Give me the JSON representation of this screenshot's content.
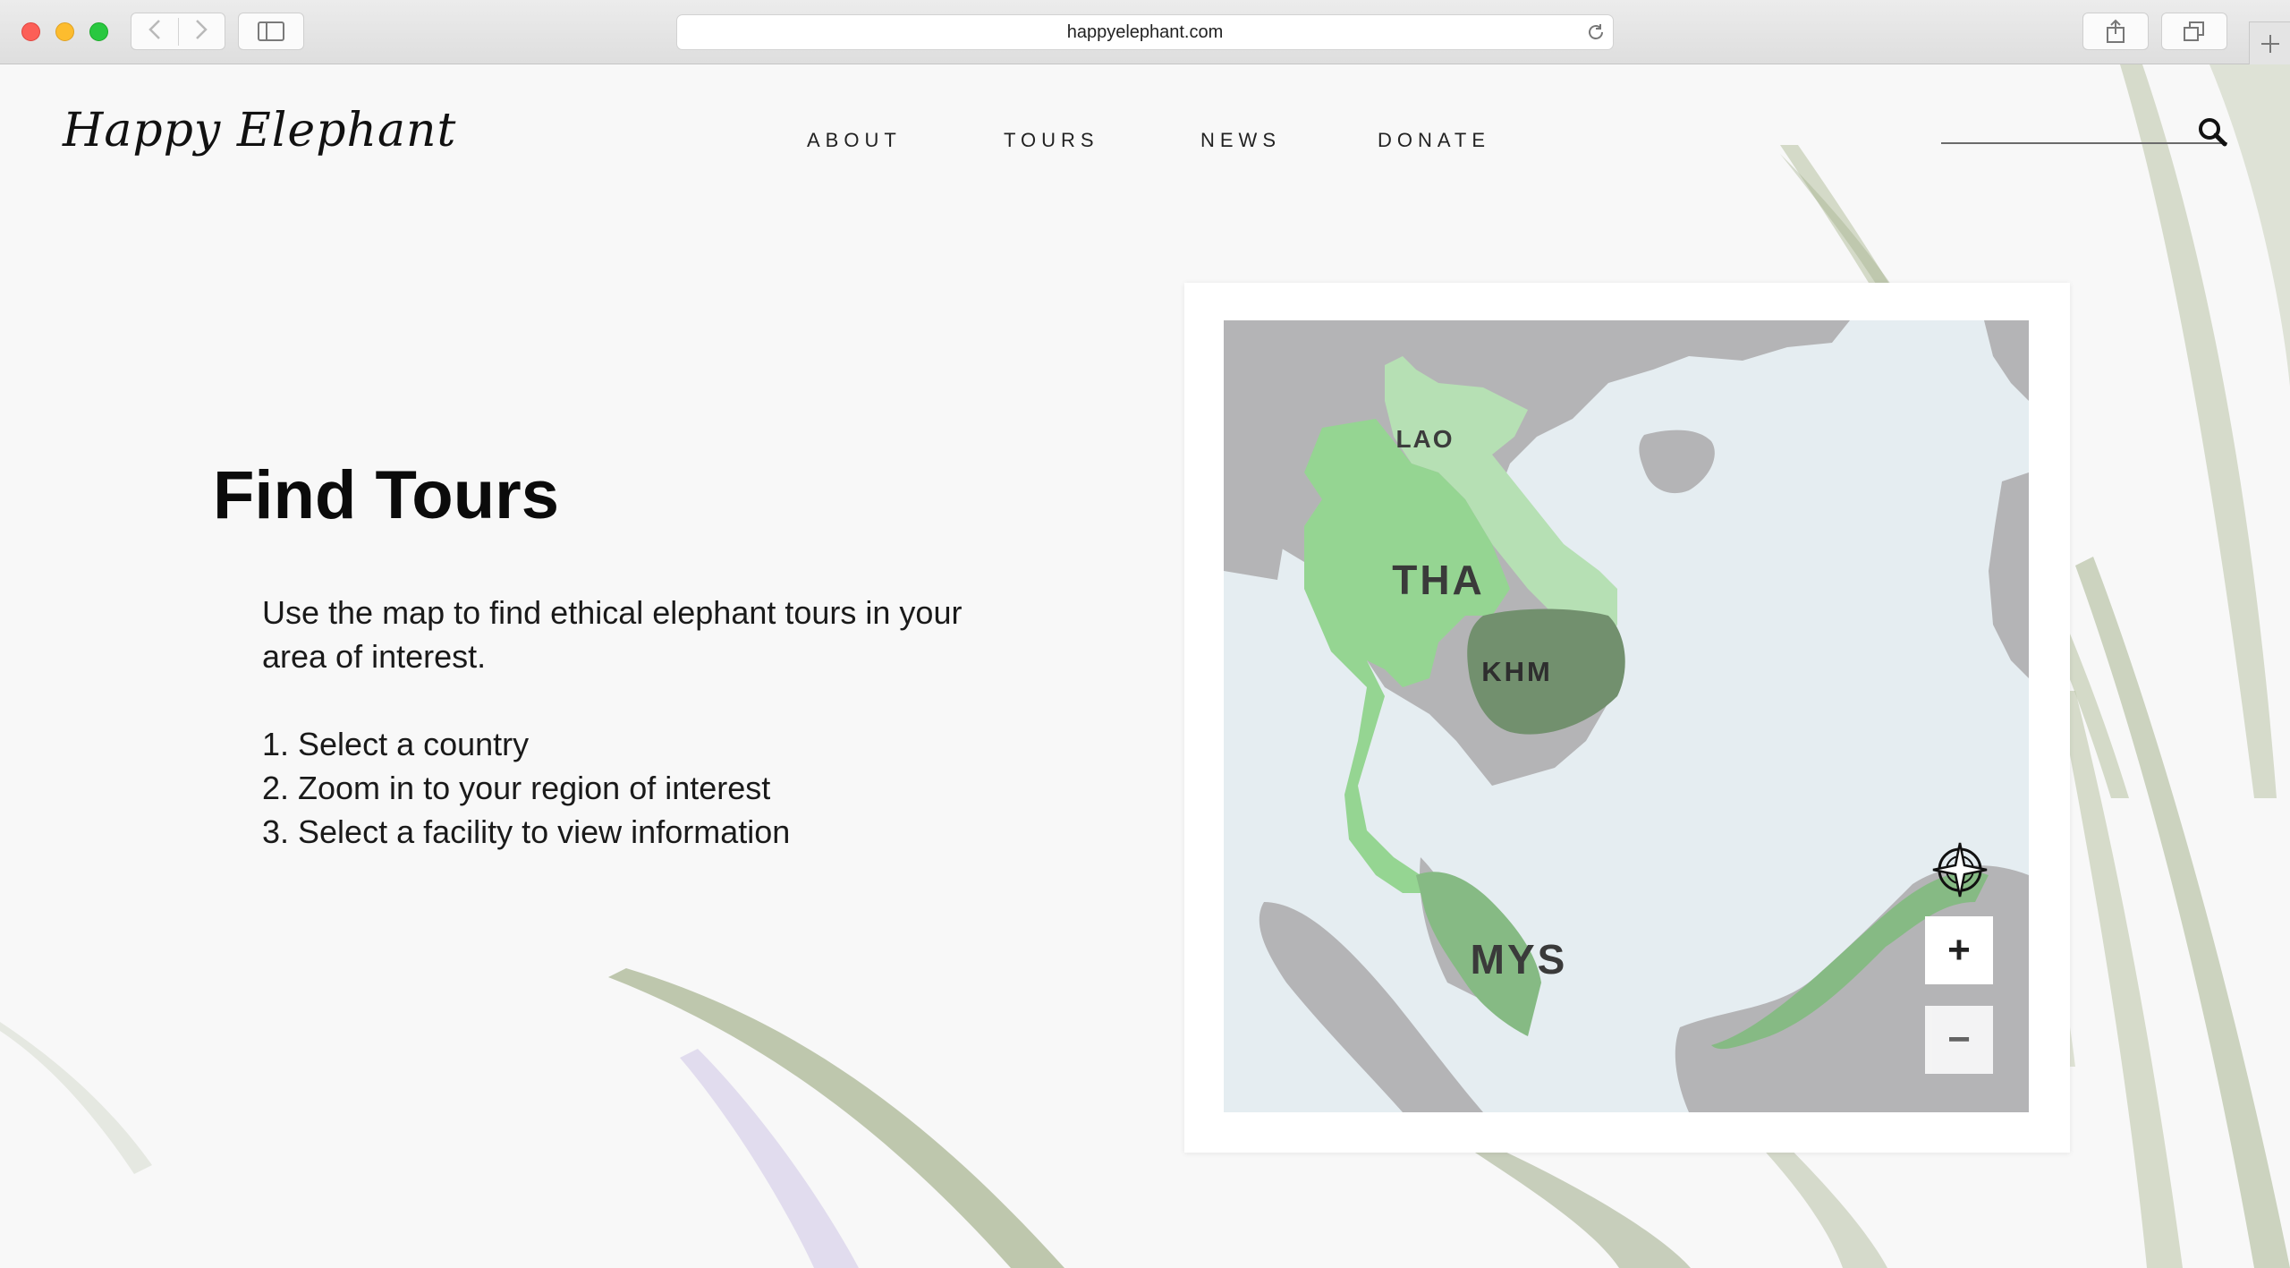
{
  "browser": {
    "url": "happyelephant.com"
  },
  "site": {
    "logo": "Happy Elephant",
    "nav": [
      "ABOUT",
      "TOURS",
      "NEWS",
      "DONATE"
    ],
    "search_placeholder": ""
  },
  "main": {
    "title": "Find Tours",
    "intro_line1": "Use the map to find ethical elephant tours in your",
    "intro_line2": "area of interest.",
    "steps": [
      "1. Select a country",
      "2. Zoom in to your region of interest",
      "3. Select a facility to view information"
    ]
  },
  "map": {
    "countries": [
      {
        "code": "LAO",
        "color": "#b6e0b4"
      },
      {
        "code": "THA",
        "color": "#95d592"
      },
      {
        "code": "KHM",
        "color": "#72906e"
      },
      {
        "code": "MYS",
        "color": "#86ba84"
      }
    ],
    "zoom_in_label": "+",
    "zoom_out_label": "−",
    "land_color": "#b4b4b6",
    "water_color": "#e5edf1"
  }
}
